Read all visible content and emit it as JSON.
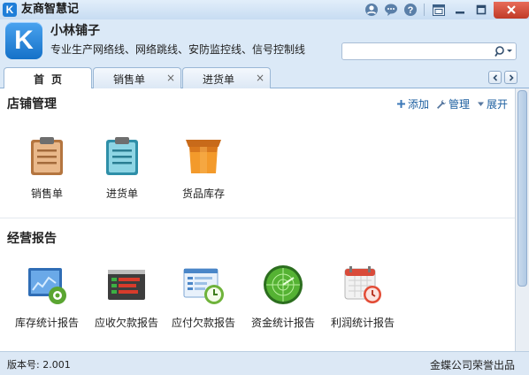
{
  "window": {
    "title": "友商智慧记",
    "app_icon_letter": "K"
  },
  "header": {
    "logo_letter": "K",
    "shop_name": "小林铺子",
    "shop_description": "专业生产网络线、网络跳线、安防监控线、信号控制线",
    "search": {
      "value": "",
      "placeholder": ""
    }
  },
  "tabs": [
    {
      "label": "首页",
      "active": true
    },
    {
      "label": "销售单",
      "closable": true
    },
    {
      "label": "进货单",
      "closable": true
    }
  ],
  "store_management": {
    "title": "店铺管理",
    "actions": {
      "add": "添加",
      "manage": "管理",
      "expand": "展开"
    },
    "tiles": [
      {
        "label": "销售单",
        "icon": "sales-order-icon"
      },
      {
        "label": "进货单",
        "icon": "purchase-order-icon"
      },
      {
        "label": "货品库存",
        "icon": "inventory-icon"
      }
    ]
  },
  "business_reports": {
    "title": "经营报告",
    "tiles": [
      {
        "label": "库存统计报告",
        "icon": "inventory-report-icon"
      },
      {
        "label": "应收欠款报告",
        "icon": "receivables-report-icon"
      },
      {
        "label": "应付欠款报告",
        "icon": "payables-report-icon"
      },
      {
        "label": "资金统计报告",
        "icon": "funds-report-icon"
      },
      {
        "label": "利润统计报告",
        "icon": "profit-report-icon"
      }
    ]
  },
  "status": {
    "version": "版本号: 2.001",
    "copyright": "金蝶公司荣誉出品"
  },
  "colors": {
    "accent": "#1f7ed8",
    "link": "#1d5fa0",
    "window_bg": "#dbe9f7"
  }
}
